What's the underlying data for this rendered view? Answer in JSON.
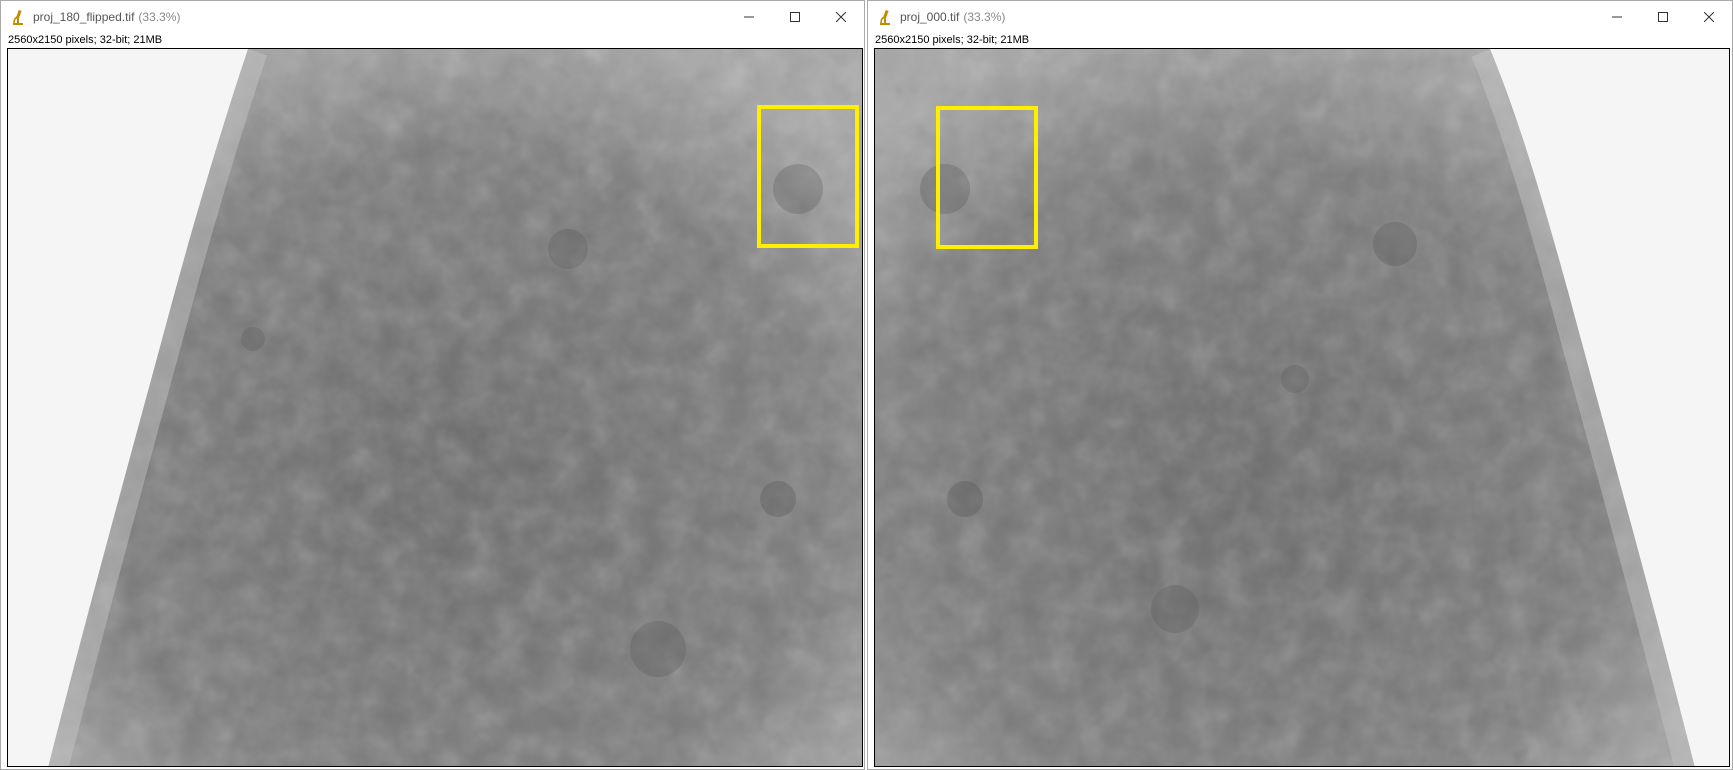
{
  "windows": [
    {
      "id": "left",
      "title": "proj_180_flipped.tif",
      "zoom": "(33.3%)",
      "info": "2560x2150 pixels; 32-bit; 21MB",
      "icon": "microscope-icon",
      "controls": [
        "minimize-icon",
        "maximize-icon",
        "close-icon"
      ]
    },
    {
      "id": "right",
      "title": "proj_000.tif",
      "zoom": "(33.3%)",
      "info": "2560x2150 pixels; 32-bit; 21MB",
      "icon": "microscope-icon",
      "controls": [
        "minimize-icon",
        "maximize-icon",
        "close-icon"
      ]
    }
  ],
  "colors": {
    "roi": "#ffee00",
    "background": "#f4f4f4",
    "specimen": "#727272",
    "specimen_edge": "#a8a8a8"
  },
  "roi": {
    "shape": "rectangle",
    "color_name": "yellow"
  }
}
